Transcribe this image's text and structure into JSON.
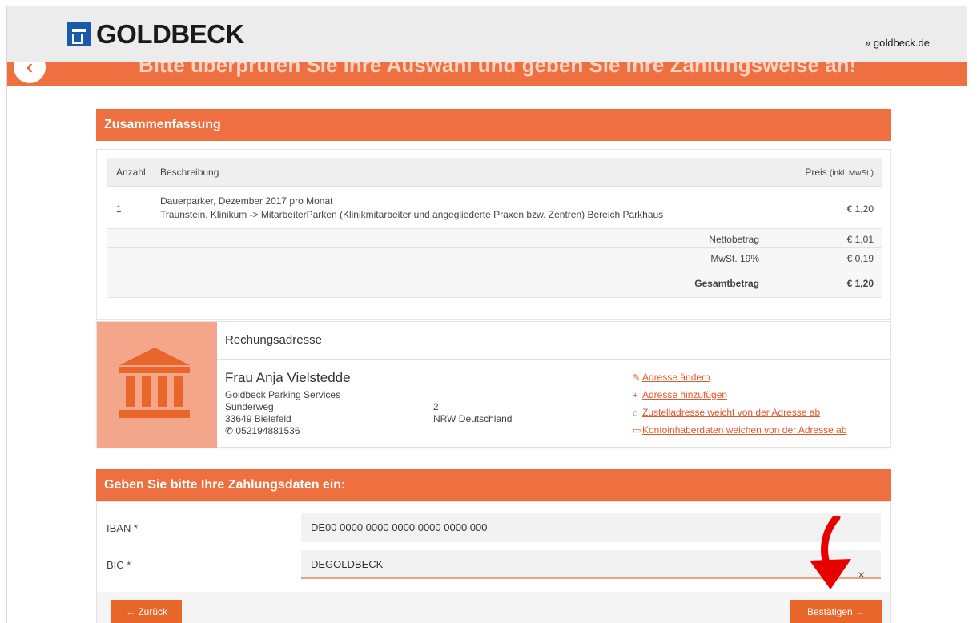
{
  "header": {
    "logo_text": "GOLDBECK",
    "site_link": "» goldbeck.de"
  },
  "banner": {
    "title": "Bitte überprüfen Sie Ihre Auswahl und geben Sie Ihre Zahlungsweise an!"
  },
  "summary": {
    "title": "Zusammenfassung",
    "columns": {
      "qty": "Anzahl",
      "desc": "Beschreibung",
      "price": "Preis",
      "price_unit": "(inkl. MwSt.)"
    },
    "item": {
      "qty": "1",
      "desc_line1": "Dauerparker, Dezember 2017 pro Monat",
      "desc_line2": "Traunstein, Klinikum -> MitarbeiterParken (Klinikmitarbeiter und angegliederte Praxen bzw. Zentren)  Bereich Parkhaus",
      "price": "€ 1,20"
    },
    "totals": [
      {
        "label": "Nettobetrag",
        "value": "€ 1,01"
      },
      {
        "label": "MwSt. 19%",
        "value": "€ 0,19"
      },
      {
        "label": "Gesamtbetrag",
        "value": "€ 1,20"
      }
    ]
  },
  "address": {
    "title": "Rechungsadresse",
    "name": "Frau Anja Vielstedde",
    "company": "Goldbeck Parking Services",
    "street": "Sunderweg",
    "house_number": "2",
    "city": "33649 Bielefeld",
    "region": "NRW Deutschland",
    "phone": "052194881536",
    "links": [
      "Adresse ändern",
      "Adresse hinzufügen",
      "Zustelladresse weicht von der Adresse ab",
      "Kontoinhaberdaten weichen von der Adresse ab"
    ]
  },
  "payment": {
    "title": "Geben Sie bitte Ihre Zahlungsdaten ein:",
    "iban_label": "IBAN *",
    "iban_value": "DE00 0000 0000 0000 0000 0000 000",
    "bic_label": "BIC *",
    "bic_value": "DEGOLDBECK",
    "clear_symbol": "×"
  },
  "buttons": {
    "back": "Zurück",
    "confirm": "Bestätigen"
  },
  "colors": {
    "accent": "#ee6f3f",
    "accent_light": "#f4a68a",
    "link": "#e8562a",
    "logo_blue": "#1a5aa8",
    "annotation_arrow": "#e60000"
  },
  "icons": {
    "back": "chevron-left-icon",
    "bank": "bank-building-icon",
    "phone": "phone-icon",
    "edit": "edit-icon",
    "plus": "plus-icon",
    "home": "home-icon",
    "card": "credit-card-icon",
    "arrow_left": "arrow-left-icon",
    "arrow_right": "arrow-right-icon"
  }
}
